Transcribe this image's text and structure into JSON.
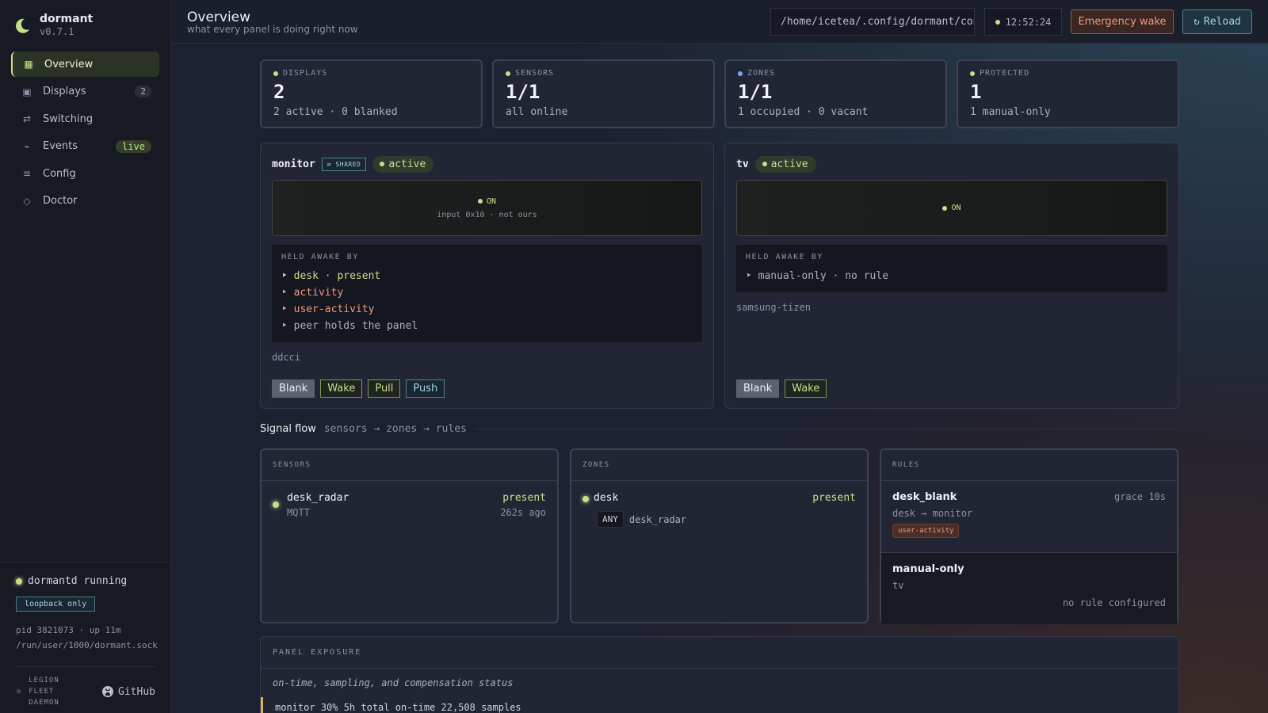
{
  "brand": {
    "name": "dormant",
    "version": "v0.7.1"
  },
  "nav": [
    {
      "label": "Overview",
      "icon": "grid-icon",
      "glyph": "▦",
      "active": true
    },
    {
      "label": "Displays",
      "icon": "display-icon",
      "glyph": "▣",
      "count": "2"
    },
    {
      "label": "Switching",
      "icon": "switch-icon",
      "glyph": "⇄"
    },
    {
      "label": "Events",
      "icon": "pulse-icon",
      "glyph": "⌁",
      "badge": "live"
    },
    {
      "label": "Config",
      "icon": "list-icon",
      "glyph": "≡"
    },
    {
      "label": "Doctor",
      "icon": "diamond-icon",
      "glyph": "◇"
    }
  ],
  "daemon": {
    "status": "dormantd running",
    "scope": "loopback only",
    "pid": "pid 3821073 · up 11m",
    "socket": "/run/user/1000/dormant.sock"
  },
  "footer": {
    "legion": [
      "LEGION",
      "FLEET",
      "DAEMON"
    ],
    "github": "GitHub"
  },
  "header": {
    "title": "Overview",
    "subtitle": "what every panel is doing right now",
    "config_path": "/home/icetea/.config/dormant/config.toml",
    "clock": "12:52:24",
    "emergency": "Emergency wake",
    "reload": "Reload"
  },
  "stats": [
    {
      "label": "DISPLAYS",
      "value": "2",
      "desc": "2 active · 0 blanked",
      "color": "#c6e08a"
    },
    {
      "label": "SENSORS",
      "value": "1/1",
      "desc": "all online",
      "color": "#c6e08a"
    },
    {
      "label": "ZONES",
      "value": "1/1",
      "desc": "1 occupied · 0 vacant",
      "color": "#7aa6f0"
    },
    {
      "label": "PROTECTED",
      "value": "1",
      "desc": "1 manual-only",
      "color": "#c6e08a"
    }
  ],
  "panels": {
    "monitor": {
      "name": "monitor",
      "shared": "⇄ SHARED",
      "state": "active",
      "screen": "ON",
      "screen_sub": "input 0x10 · not ours",
      "held_title": "HELD AWAKE BY",
      "held": [
        "desk · present",
        "activity",
        "user-activity",
        "peer holds the panel"
      ],
      "driver": "ddcci",
      "actions": [
        "Blank",
        "Wake",
        "Pull",
        "Push"
      ]
    },
    "tv": {
      "name": "tv",
      "state": "active",
      "screen": "ON",
      "held_title": "HELD AWAKE BY",
      "held": [
        "manual-only · no rule"
      ],
      "driver": "samsung-tizen",
      "actions": [
        "Blank",
        "Wake"
      ]
    }
  },
  "signal": {
    "title": "Signal flow",
    "subtitle": "sensors → zones → rules"
  },
  "sensors": {
    "title": "SENSORS",
    "name": "desk_radar",
    "kind": "MQTT",
    "state": "present",
    "age": "262s ago"
  },
  "zones": {
    "title": "ZONES",
    "name": "desk",
    "state": "present",
    "mode": "ANY",
    "member": "desk_radar"
  },
  "rules": {
    "title": "RULES",
    "items": [
      {
        "name": "desk_blank",
        "grace": "grace 10s",
        "path": "desk → monitor",
        "tag": "user-activity"
      },
      {
        "name": "manual-only",
        "target": "tv",
        "note": "no rule configured"
      }
    ]
  },
  "exposure": {
    "title": "PANEL EXPOSURE",
    "subtitle": "on-time, sampling, and compensation status",
    "row": "monitor  30% 5h total on-time  22,508 samples"
  }
}
